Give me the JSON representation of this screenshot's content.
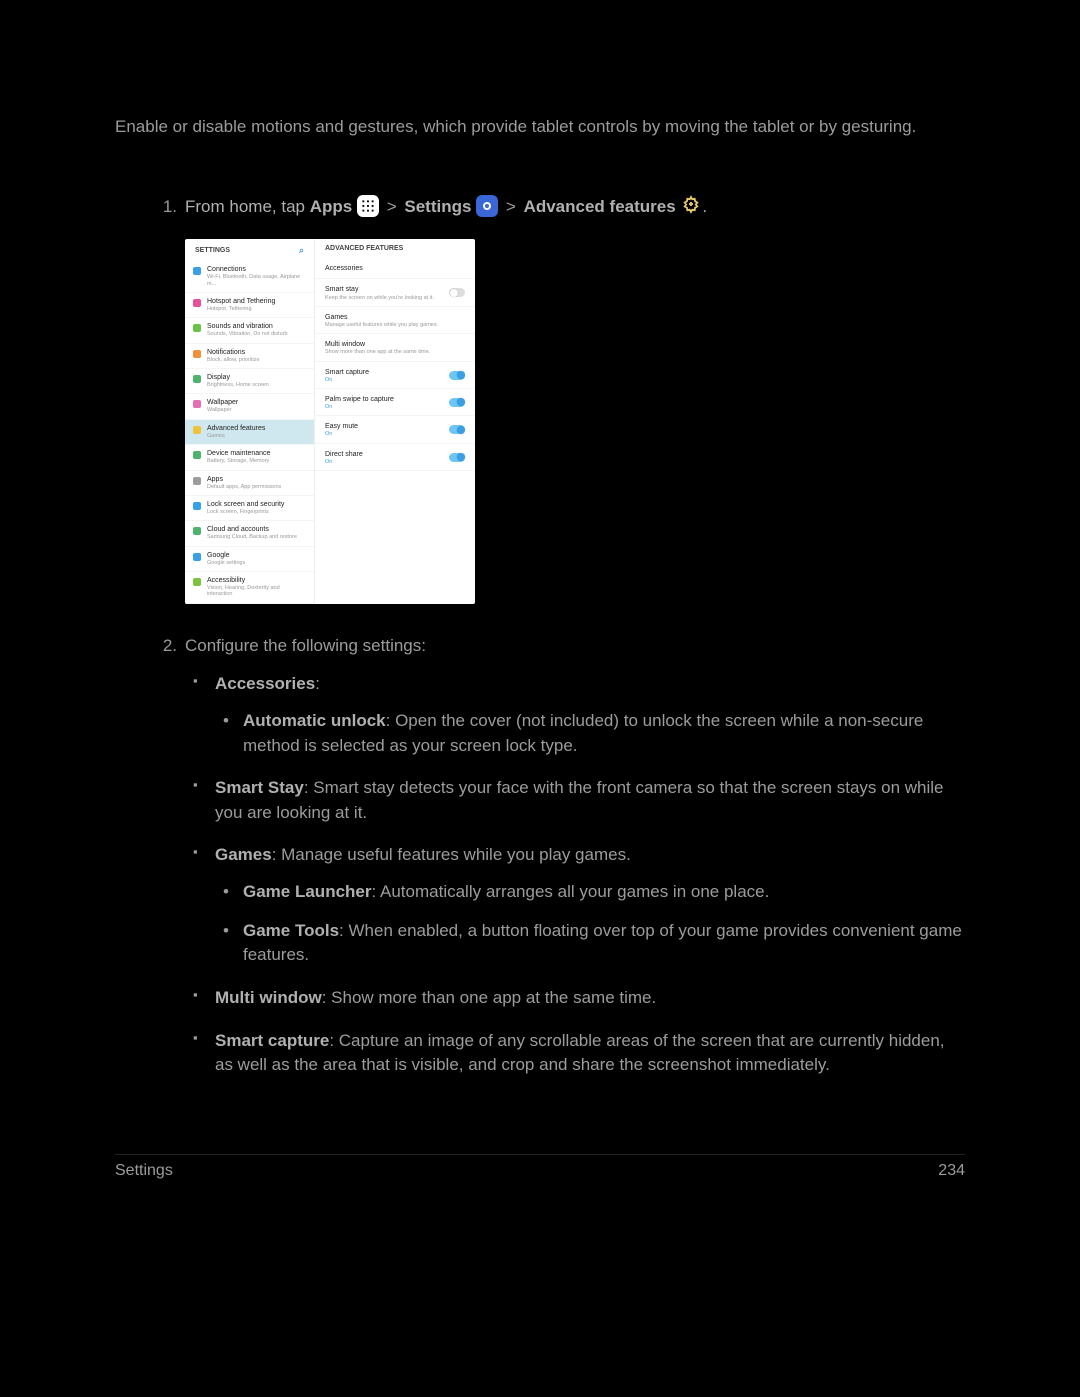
{
  "intro": "Enable or disable motions and gestures, which provide tablet controls by moving the tablet or by gesturing.",
  "step1": {
    "num": "1.",
    "prefix": "From home, tap ",
    "apps": "Apps",
    "settings": "Settings",
    "advanced": "Advanced features",
    "sep": ">"
  },
  "screenshot": {
    "left_header": "SETTINGS",
    "right_header": "ADVANCED FEATURES",
    "left": [
      {
        "title": "Connections",
        "sub": "Wi-Fi, Bluetooth, Data usage, Airplane m...",
        "color": "#3aa0e6",
        "sel": false
      },
      {
        "title": "Hotspot and Tethering",
        "sub": "Hotspot, Tethering",
        "color": "#e84f9a",
        "sel": false
      },
      {
        "title": "Sounds and vibration",
        "sub": "Sounds, Vibration, Do not disturb",
        "color": "#6fbf4b",
        "sel": false
      },
      {
        "title": "Notifications",
        "sub": "Block, allow, prioritize",
        "color": "#f08f3c",
        "sel": false
      },
      {
        "title": "Display",
        "sub": "Brightness, Home screen",
        "color": "#4fb36f",
        "sel": false
      },
      {
        "title": "Wallpaper",
        "sub": "Wallpaper",
        "color": "#e36fb5",
        "sel": false
      },
      {
        "title": "Advanced features",
        "sub": "Games",
        "color": "#f0c23c",
        "sel": true
      },
      {
        "title": "Device maintenance",
        "sub": "Battery, Storage, Memory",
        "color": "#4fb36f",
        "sel": false
      },
      {
        "title": "Apps",
        "sub": "Default apps, App permissions",
        "color": "#9c9c9c",
        "sel": false
      },
      {
        "title": "Lock screen and security",
        "sub": "Lock screen, Fingerprints",
        "color": "#3aa0e6",
        "sel": false
      },
      {
        "title": "Cloud and accounts",
        "sub": "Samsung Cloud, Backup and restore",
        "color": "#4fb36f",
        "sel": false
      },
      {
        "title": "Google",
        "sub": "Google settings",
        "color": "#3aa0e6",
        "sel": false
      },
      {
        "title": "Accessibility",
        "sub": "Vision, Hearing, Dexterity and interaction",
        "color": "#7ec13e",
        "sel": false
      }
    ],
    "right": [
      {
        "title": "Accessories",
        "sub": "",
        "toggle": ""
      },
      {
        "title": "Smart stay",
        "sub": "Keep the screen on while you're looking at it.",
        "toggle": "off"
      },
      {
        "title": "Games",
        "sub": "Manage useful features while you play games.",
        "toggle": ""
      },
      {
        "title": "Multi window",
        "sub": "Show more than one app at the same time.",
        "toggle": ""
      },
      {
        "title": "Smart capture",
        "sub": "On",
        "toggle": "on"
      },
      {
        "title": "Palm swipe to capture",
        "sub": "On",
        "toggle": "on"
      },
      {
        "title": "Easy mute",
        "sub": "On",
        "toggle": "on"
      },
      {
        "title": "Direct share",
        "sub": "On",
        "toggle": "on"
      }
    ]
  },
  "step2": {
    "num": "2.",
    "text": "Configure the following settings:",
    "items": [
      {
        "title": "Accessories",
        "text": ":",
        "sub": [
          {
            "title": "Automatic unlock",
            "text": ": Open the cover (not included) to unlock the screen while a non-secure method is selected as your screen lock type."
          }
        ]
      },
      {
        "title": "Smart Stay",
        "text": ": Smart stay detects your face with the front camera so that the screen stays on while you are looking at it.",
        "sub": []
      },
      {
        "title": "Games",
        "text": ": Manage useful features while you play games.",
        "sub": [
          {
            "title": "Game Launcher",
            "text": ": Automatically arranges all your games in one place."
          },
          {
            "title": "Game Tools",
            "text": ": When enabled, a button floating over top of your game provides convenient game features."
          }
        ]
      },
      {
        "title": "Multi window",
        "text": ": Show more than one app at the same time.",
        "sub": []
      },
      {
        "title": "Smart capture",
        "text": ": Capture an image of any scrollable areas of the screen that are currently hidden, as well as the area that is visible, and crop and share the screenshot immediately.",
        "sub": []
      }
    ]
  },
  "footer": {
    "section": "Settings",
    "page": "234"
  }
}
